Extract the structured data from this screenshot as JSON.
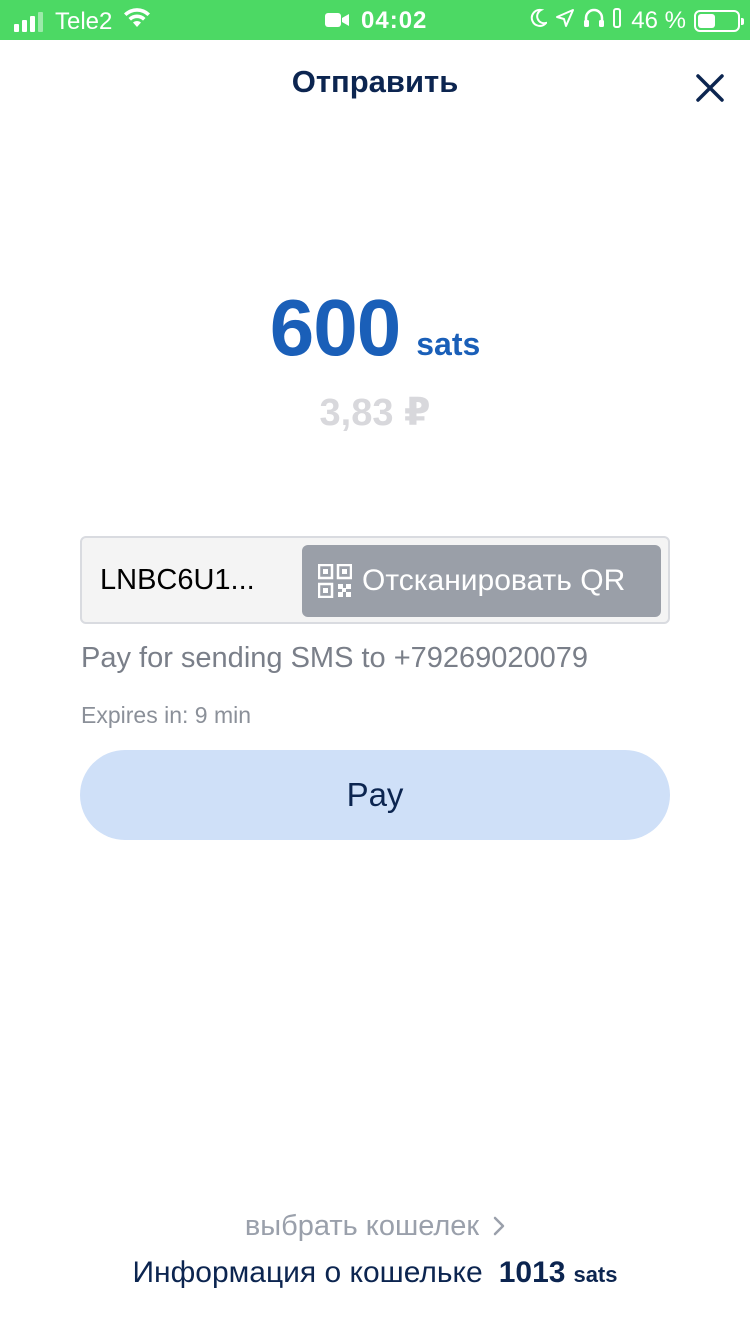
{
  "status_bar": {
    "carrier": "Tele2",
    "time": "04:02",
    "battery_percent": "46 %",
    "battery_level": 0.46,
    "background": "#4cd964"
  },
  "header": {
    "title": "Отправить",
    "close_icon": "close-icon"
  },
  "amount": {
    "value": "600",
    "unit": "sats",
    "fiat": "3,83 ₽",
    "color": "#1a5fb8"
  },
  "invoice": {
    "value": "LNBC6U1...",
    "scan_label": "Отсканировать QR",
    "scan_icon": "qr-code-icon"
  },
  "memo": "Pay for sending SMS to +79269020079",
  "expires": "Expires in: 9 min",
  "pay_button": {
    "label": "Pay",
    "background": "#cfe0f8"
  },
  "footer": {
    "choose_wallet": "выбрать кошелек",
    "wallet_info_label": "Информация о кошельке",
    "balance": "1013",
    "balance_unit": "sats"
  }
}
